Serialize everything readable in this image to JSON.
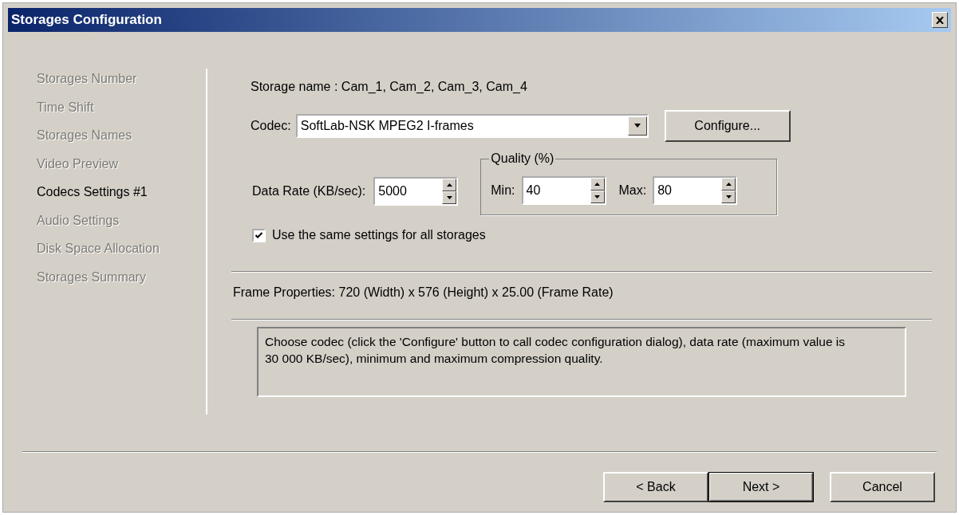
{
  "window": {
    "title": "Storages Configuration"
  },
  "steps": [
    {
      "label": "Storages Number",
      "selected": false
    },
    {
      "label": "Time Shift",
      "selected": false
    },
    {
      "label": "Storages Names",
      "selected": false
    },
    {
      "label": "Video Preview",
      "selected": false
    },
    {
      "label": "Codecs Settings #1",
      "selected": true
    },
    {
      "label": "Audio Settings",
      "selected": false
    },
    {
      "label": "Disk Space Allocation",
      "selected": false
    },
    {
      "label": "Storages Summary",
      "selected": false
    }
  ],
  "storage_name": "Storage name : Cam_1, Cam_2, Cam_3, Cam_4",
  "codec": {
    "label": "Codec:",
    "value": "SoftLab-NSK MPEG2 I-frames",
    "configure_button": "Configure..."
  },
  "data_rate": {
    "label": "Data Rate (KB/sec):",
    "value": "5000"
  },
  "quality": {
    "title": "Quality (%)",
    "min_label": "Min:",
    "min_value": "40",
    "max_label": "Max:",
    "max_value": "80"
  },
  "same_settings": {
    "label": "Use the same settings for all storages",
    "checked": true
  },
  "frame_properties": "Frame Properties: 720 (Width) x 576 (Height) x 25.00 (Frame Rate)",
  "description": "Choose codec (click the 'Configure' button to call codec configuration dialog), data rate (maximum value is 30 000 KB/sec), minimum and maximum compression quality.",
  "buttons": [
    {
      "label": "< Back",
      "default": false
    },
    {
      "label": "Next >",
      "default": true
    },
    {
      "label": "Cancel",
      "default": false
    }
  ]
}
